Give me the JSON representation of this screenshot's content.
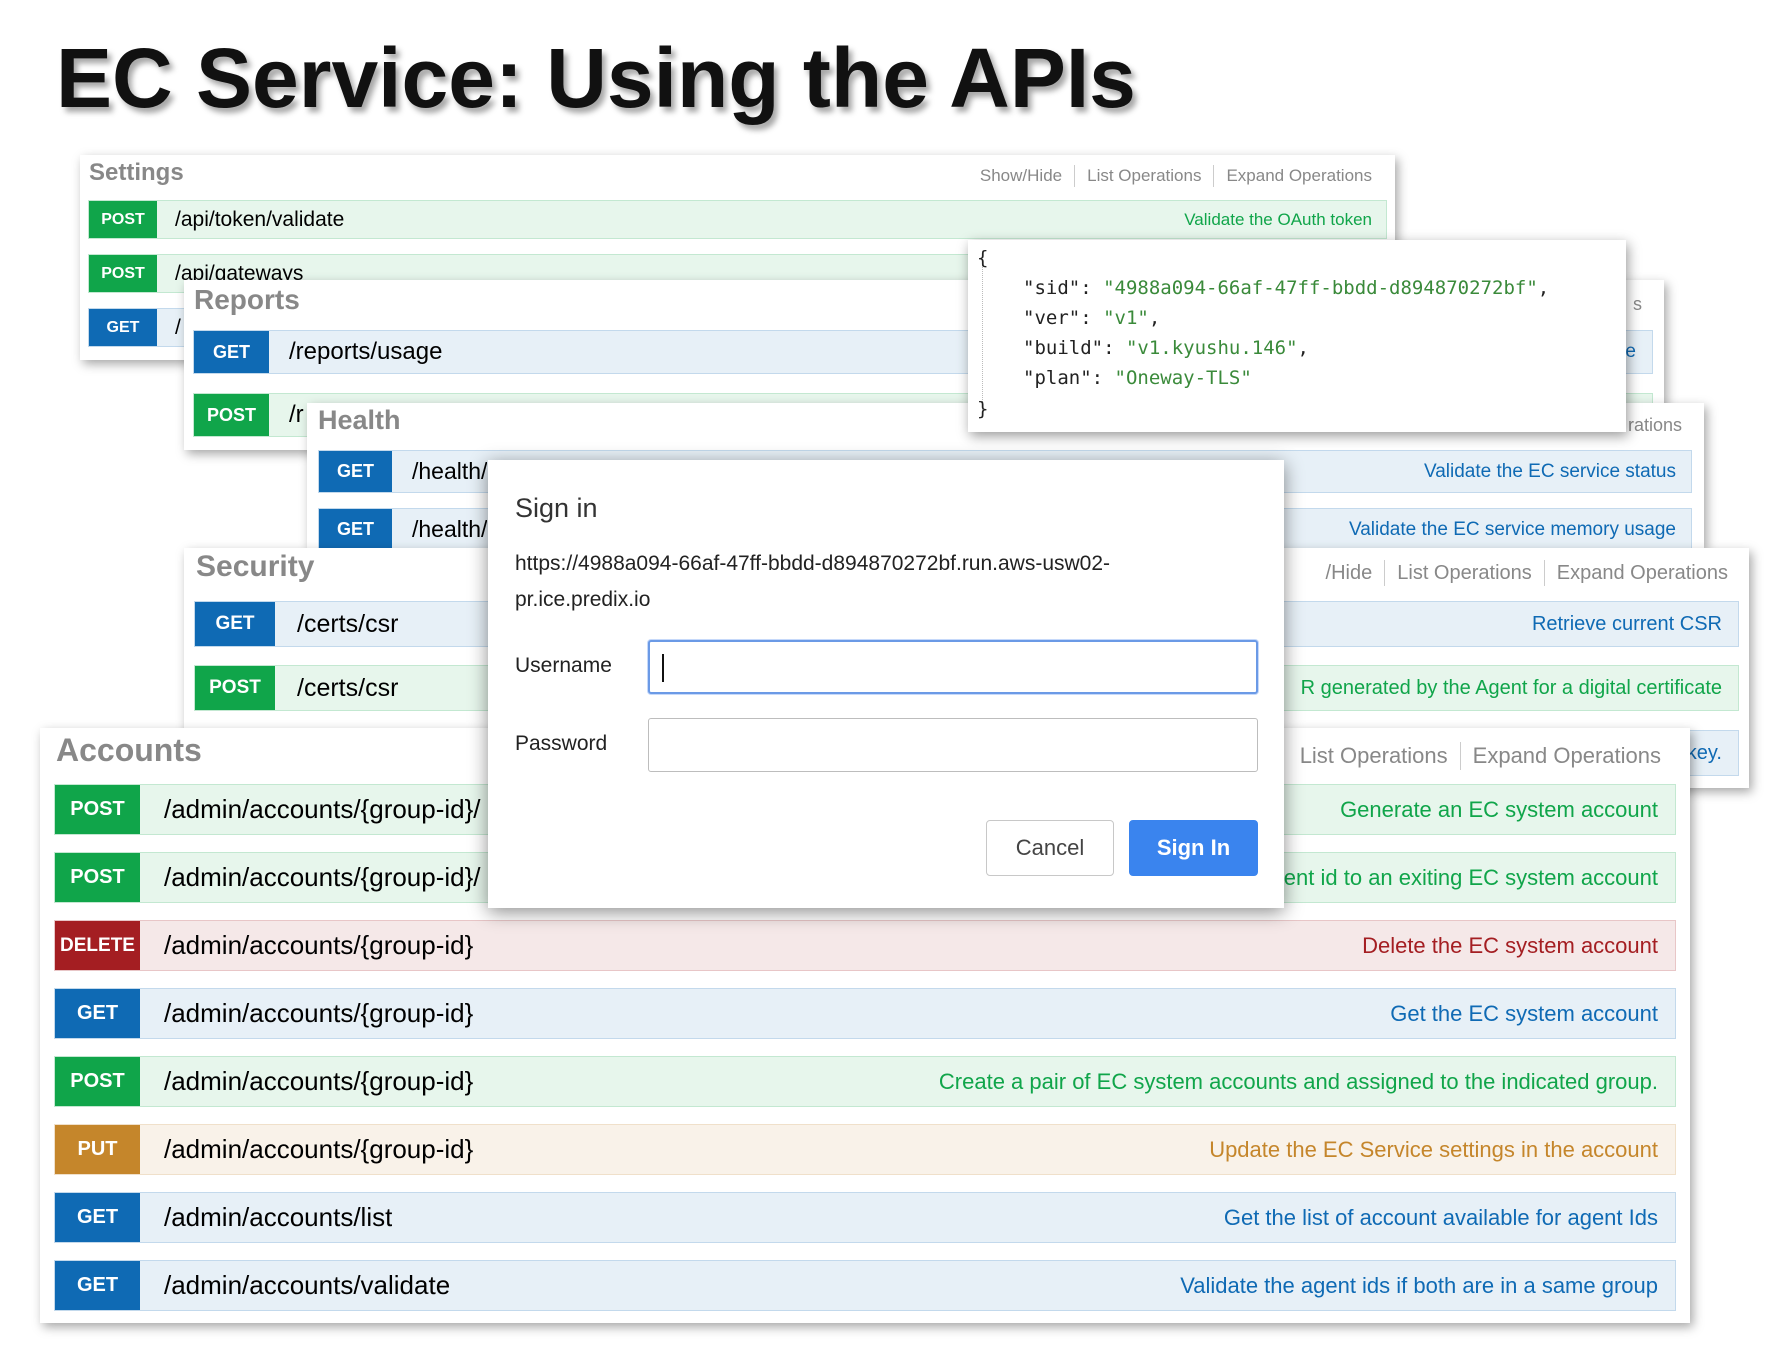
{
  "slide": {
    "title": "EC Service: Using the APIs"
  },
  "settings": {
    "title": "Settings",
    "links": [
      "Show/Hide",
      "List Operations",
      "Expand Operations"
    ],
    "ops": [
      {
        "method": "POST",
        "path": "/api/token/validate",
        "desc": "Validate the OAuth token"
      },
      {
        "method": "POST",
        "path": "/api/gateways",
        "desc": ""
      },
      {
        "method": "GET",
        "path": "/",
        "desc": ""
      }
    ]
  },
  "reports": {
    "title": "Reports",
    "links_tail": "s",
    "ops": [
      {
        "method": "GET",
        "path": "/reports/usage",
        "desc_tail": "e"
      },
      {
        "method": "POST",
        "path": "/r",
        "desc_tail": ""
      }
    ]
  },
  "health": {
    "title": "Health",
    "links_tail": "rations",
    "ops": [
      {
        "method": "GET",
        "path": "/health/",
        "desc": "Validate the EC service status"
      },
      {
        "method": "GET",
        "path": "/health/",
        "desc": "Validate the EC service memory usage"
      }
    ]
  },
  "security": {
    "title": "Security",
    "links": [
      "/Hide",
      "List Operations",
      "Expand Operations"
    ],
    "ops": [
      {
        "method": "GET",
        "path": "/certs/csr",
        "desc": "Retrieve current CSR"
      },
      {
        "method": "POST",
        "path": "/certs/csr",
        "desc": "R generated by the Agent for a digital certificate"
      },
      {
        "method": "",
        "path": "",
        "desc": "key."
      }
    ]
  },
  "accounts": {
    "title": "Accounts",
    "links": [
      "List Operations",
      "Expand Operations"
    ],
    "ops": [
      {
        "method": "POST",
        "path": "/admin/accounts/{group-id}/",
        "desc": "Generate an EC system account"
      },
      {
        "method": "POST",
        "path": "/admin/accounts/{group-id}/",
        "desc": "ent id to an exiting EC system account"
      },
      {
        "method": "DELETE",
        "path": "/admin/accounts/{group-id}",
        "desc": "Delete the EC system account"
      },
      {
        "method": "GET",
        "path": "/admin/accounts/{group-id}",
        "desc": "Get the EC system account"
      },
      {
        "method": "POST",
        "path": "/admin/accounts/{group-id}",
        "desc": "Create a pair of EC system accounts and assigned to the indicated group."
      },
      {
        "method": "PUT",
        "path": "/admin/accounts/{group-id}",
        "desc": "Update the EC Service settings in the account"
      },
      {
        "method": "GET",
        "path": "/admin/accounts/list",
        "desc": "Get the list of account available for agent Ids"
      },
      {
        "method": "GET",
        "path": "/admin/accounts/validate",
        "desc": "Validate the agent ids if both are in a same group"
      }
    ]
  },
  "json_popup": {
    "open": "{",
    "close": "}",
    "entries": [
      {
        "key": "\"sid\": ",
        "value": "\"4988a094-66af-47ff-bbdd-d894870272bf\"",
        "trail": ","
      },
      {
        "key": "\"ver\": ",
        "value": "\"v1\"",
        "trail": ","
      },
      {
        "key": "\"build\": ",
        "value": "\"v1.kyushu.146\"",
        "trail": ","
      },
      {
        "key": "\"plan\": ",
        "value": "\"Oneway-TLS\"",
        "trail": ""
      }
    ]
  },
  "signin": {
    "title": "Sign in",
    "url_line1": "https://4988a094-66af-47ff-bbdd-d894870272bf.run.aws-usw02-",
    "url_line2": "pr.ice.predix.io",
    "username_label": "Username",
    "username_value": "",
    "password_label": "Password",
    "password_value": "",
    "cancel_label": "Cancel",
    "signin_label": "Sign In"
  },
  "colors": {
    "get": "#0f6ab4",
    "post": "#10a54a",
    "delete": "#a41e22",
    "put": "#c5862b",
    "signin_button": "#3a84ee"
  }
}
